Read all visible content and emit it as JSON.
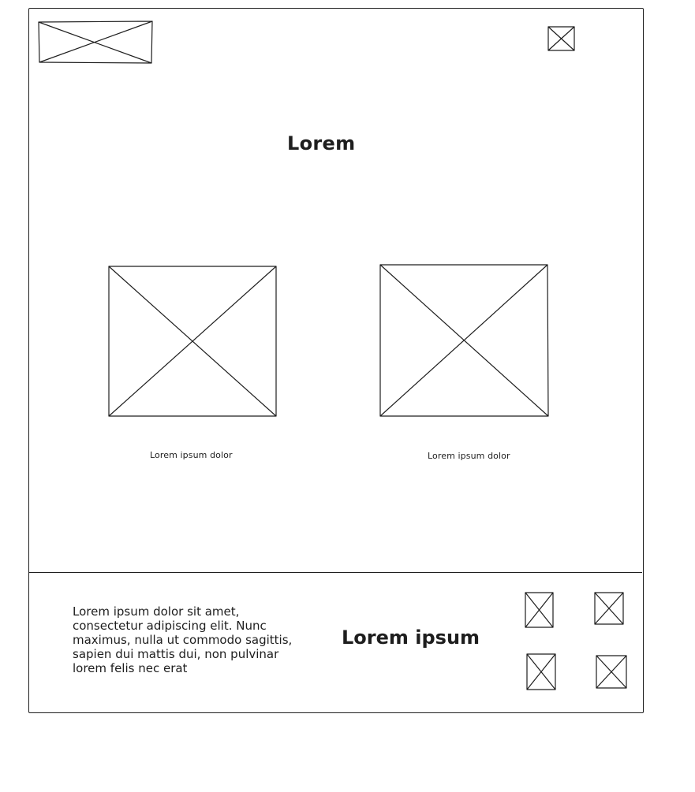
{
  "header": {
    "logo_icon": "image-placeholder-icon",
    "menu_icon": "image-placeholder-icon"
  },
  "main": {
    "title": "Lorem",
    "cards": [
      {
        "image_icon": "image-placeholder-icon",
        "caption": "Lorem ipsum dolor"
      },
      {
        "image_icon": "image-placeholder-icon",
        "caption": "Lorem ipsum dolor"
      }
    ]
  },
  "footer": {
    "text": "Lorem ipsum dolor sit amet, consectetur adipiscing elit. Nunc maximus, nulla ut commodo sagittis, sapien dui mattis dui, non pulvinar lorem felis nec erat",
    "title": "Lorem ipsum",
    "social_icons": [
      "image-placeholder-icon",
      "image-placeholder-icon",
      "image-placeholder-icon",
      "image-placeholder-icon"
    ]
  },
  "colors": {
    "stroke": "#1e1e1e",
    "background": "#ffffff"
  }
}
